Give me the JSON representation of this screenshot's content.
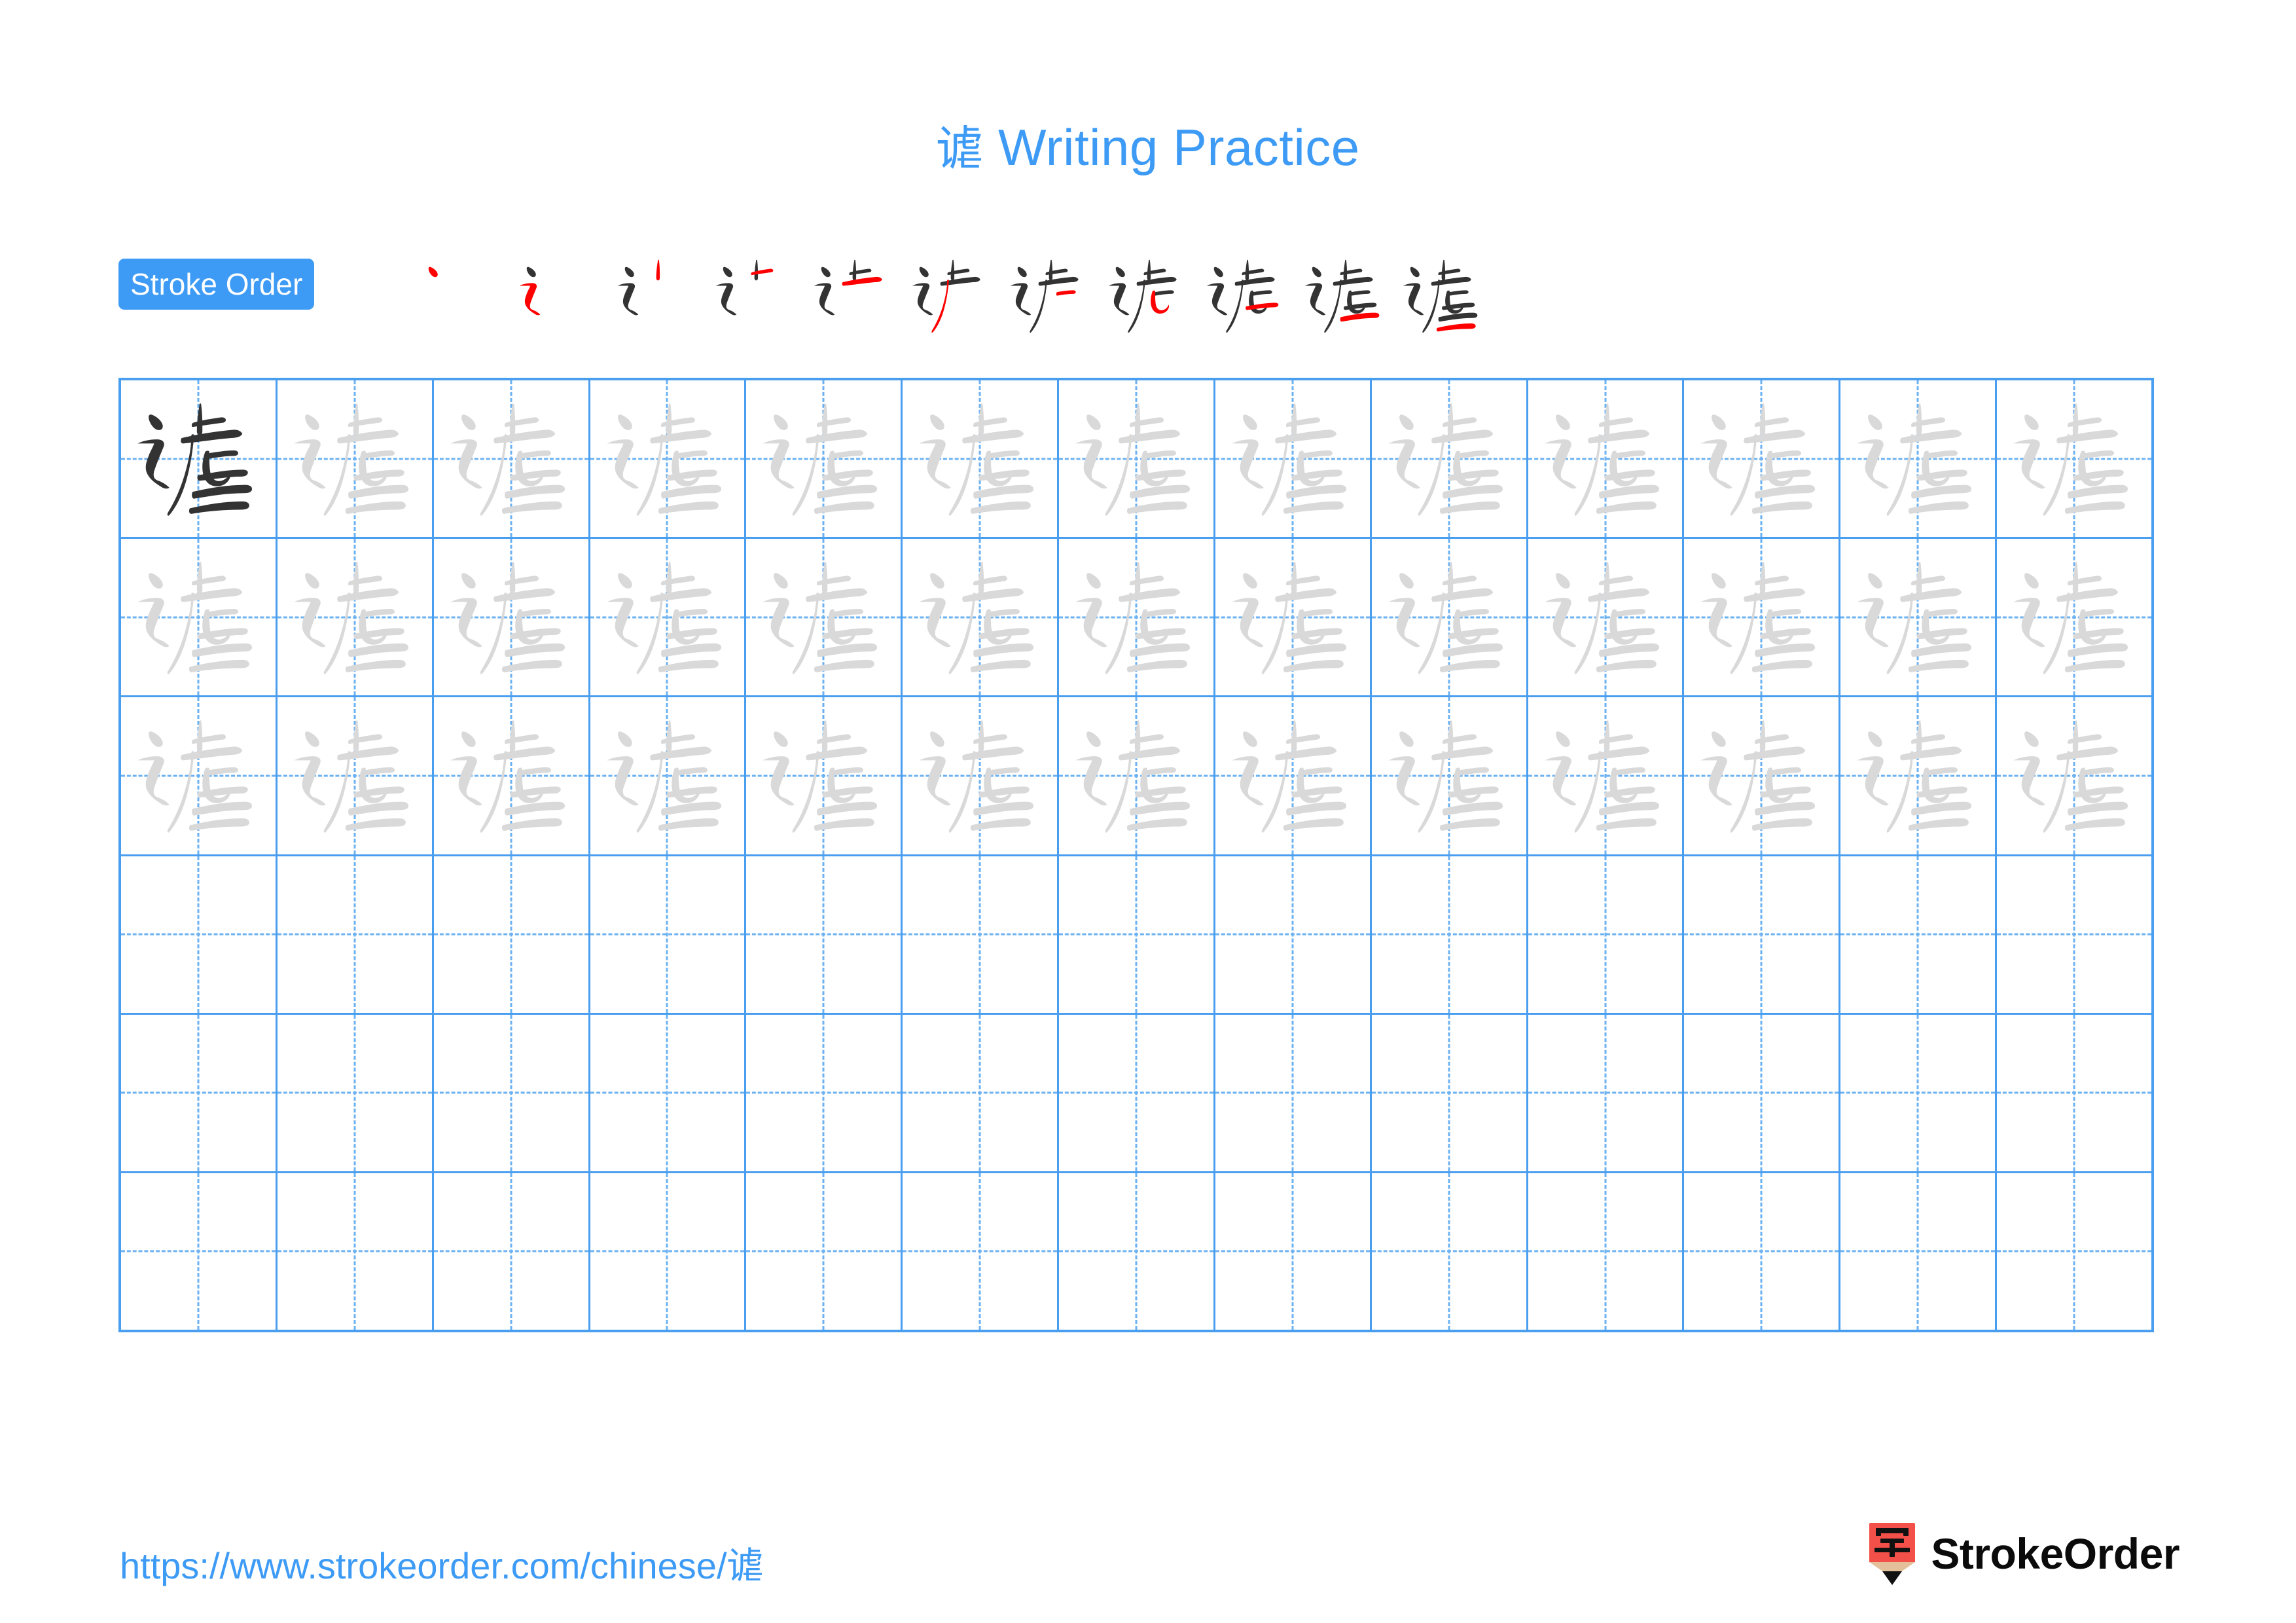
{
  "page": {
    "character": "谑",
    "title_suffix": " Writing Practice",
    "title_full": "谑 Writing Practice"
  },
  "colors": {
    "accent_blue": "#3d9bf5",
    "grid_blue": "#4a9ef0",
    "guide_blue": "#6cb2f2",
    "new_stroke_red": "#ff0000",
    "done_stroke_dark": "#333333",
    "ghost_gray": "#d9d9d9",
    "logo_red": "#f4504a",
    "logo_tan": "#e3c09a"
  },
  "stroke_order": {
    "badge_label": "Stroke Order",
    "total_strokes": 11,
    "steps": [
      {
        "index": 1,
        "new_stroke_name": "dian"
      },
      {
        "index": 2,
        "new_stroke_name": "heng-zhe-ti"
      },
      {
        "index": 3,
        "new_stroke_name": "shu"
      },
      {
        "index": 4,
        "new_stroke_name": "heng"
      },
      {
        "index": 5,
        "new_stroke_name": "heng-gou"
      },
      {
        "index": 6,
        "new_stroke_name": "pie"
      },
      {
        "index": 7,
        "new_stroke_name": "heng"
      },
      {
        "index": 8,
        "new_stroke_name": "shu-wan-gou"
      },
      {
        "index": 9,
        "new_stroke_name": "heng"
      },
      {
        "index": 10,
        "new_stroke_name": "heng"
      },
      {
        "index": 11,
        "new_stroke_name": "heng"
      }
    ]
  },
  "practice_grid": {
    "columns": 13,
    "rows": 6,
    "rows_detail": [
      {
        "row": 1,
        "first_cell_style": "solid-dark",
        "other_cells_style": "ghost-gray",
        "filled": true
      },
      {
        "row": 2,
        "first_cell_style": "ghost-gray",
        "other_cells_style": "ghost-gray",
        "filled": true
      },
      {
        "row": 3,
        "first_cell_style": "ghost-gray",
        "other_cells_style": "ghost-gray",
        "filled": true
      },
      {
        "row": 4,
        "first_cell_style": "empty",
        "other_cells_style": "empty",
        "filled": false
      },
      {
        "row": 5,
        "first_cell_style": "empty",
        "other_cells_style": "empty",
        "filled": false
      },
      {
        "row": 6,
        "first_cell_style": "empty",
        "other_cells_style": "empty",
        "filled": false
      }
    ]
  },
  "footer": {
    "url": "https://www.strokeorder.com/chinese/谑",
    "brand_name": "StrokeOrder",
    "brand_mark_character": "字"
  }
}
